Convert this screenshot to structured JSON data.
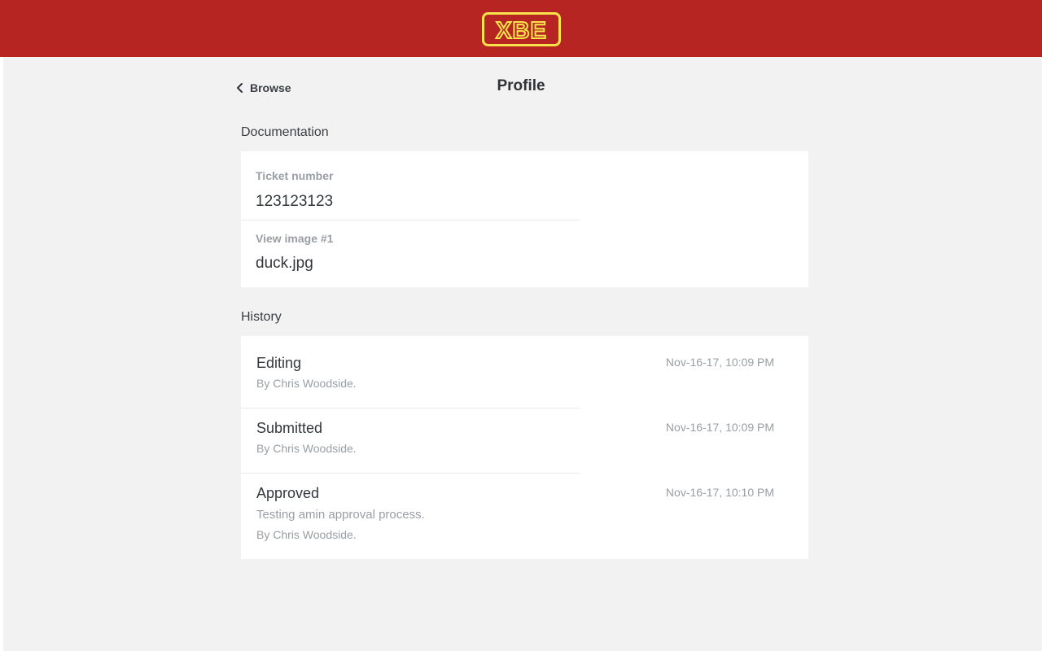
{
  "header": {
    "logo_text": "XBE",
    "brand_color": "#b72522",
    "logo_color": "#f7e34a"
  },
  "nav": {
    "back_label": "Browse",
    "page_title": "Profile"
  },
  "documentation": {
    "title": "Documentation",
    "fields": [
      {
        "label": "Ticket number",
        "value": "123123123"
      },
      {
        "label": "View image #1",
        "value": "duck.jpg"
      }
    ]
  },
  "history": {
    "title": "History",
    "items": [
      {
        "status": "Editing",
        "note": "",
        "by": "By Chris Woodside.",
        "time": "Nov-16-17, 10:09 PM"
      },
      {
        "status": "Submitted",
        "note": "",
        "by": "By Chris Woodside.",
        "time": "Nov-16-17, 10:09 PM"
      },
      {
        "status": "Approved",
        "note": "Testing amin approval process.",
        "by": "By Chris Woodside.",
        "time": "Nov-16-17, 10:10 PM"
      }
    ]
  }
}
